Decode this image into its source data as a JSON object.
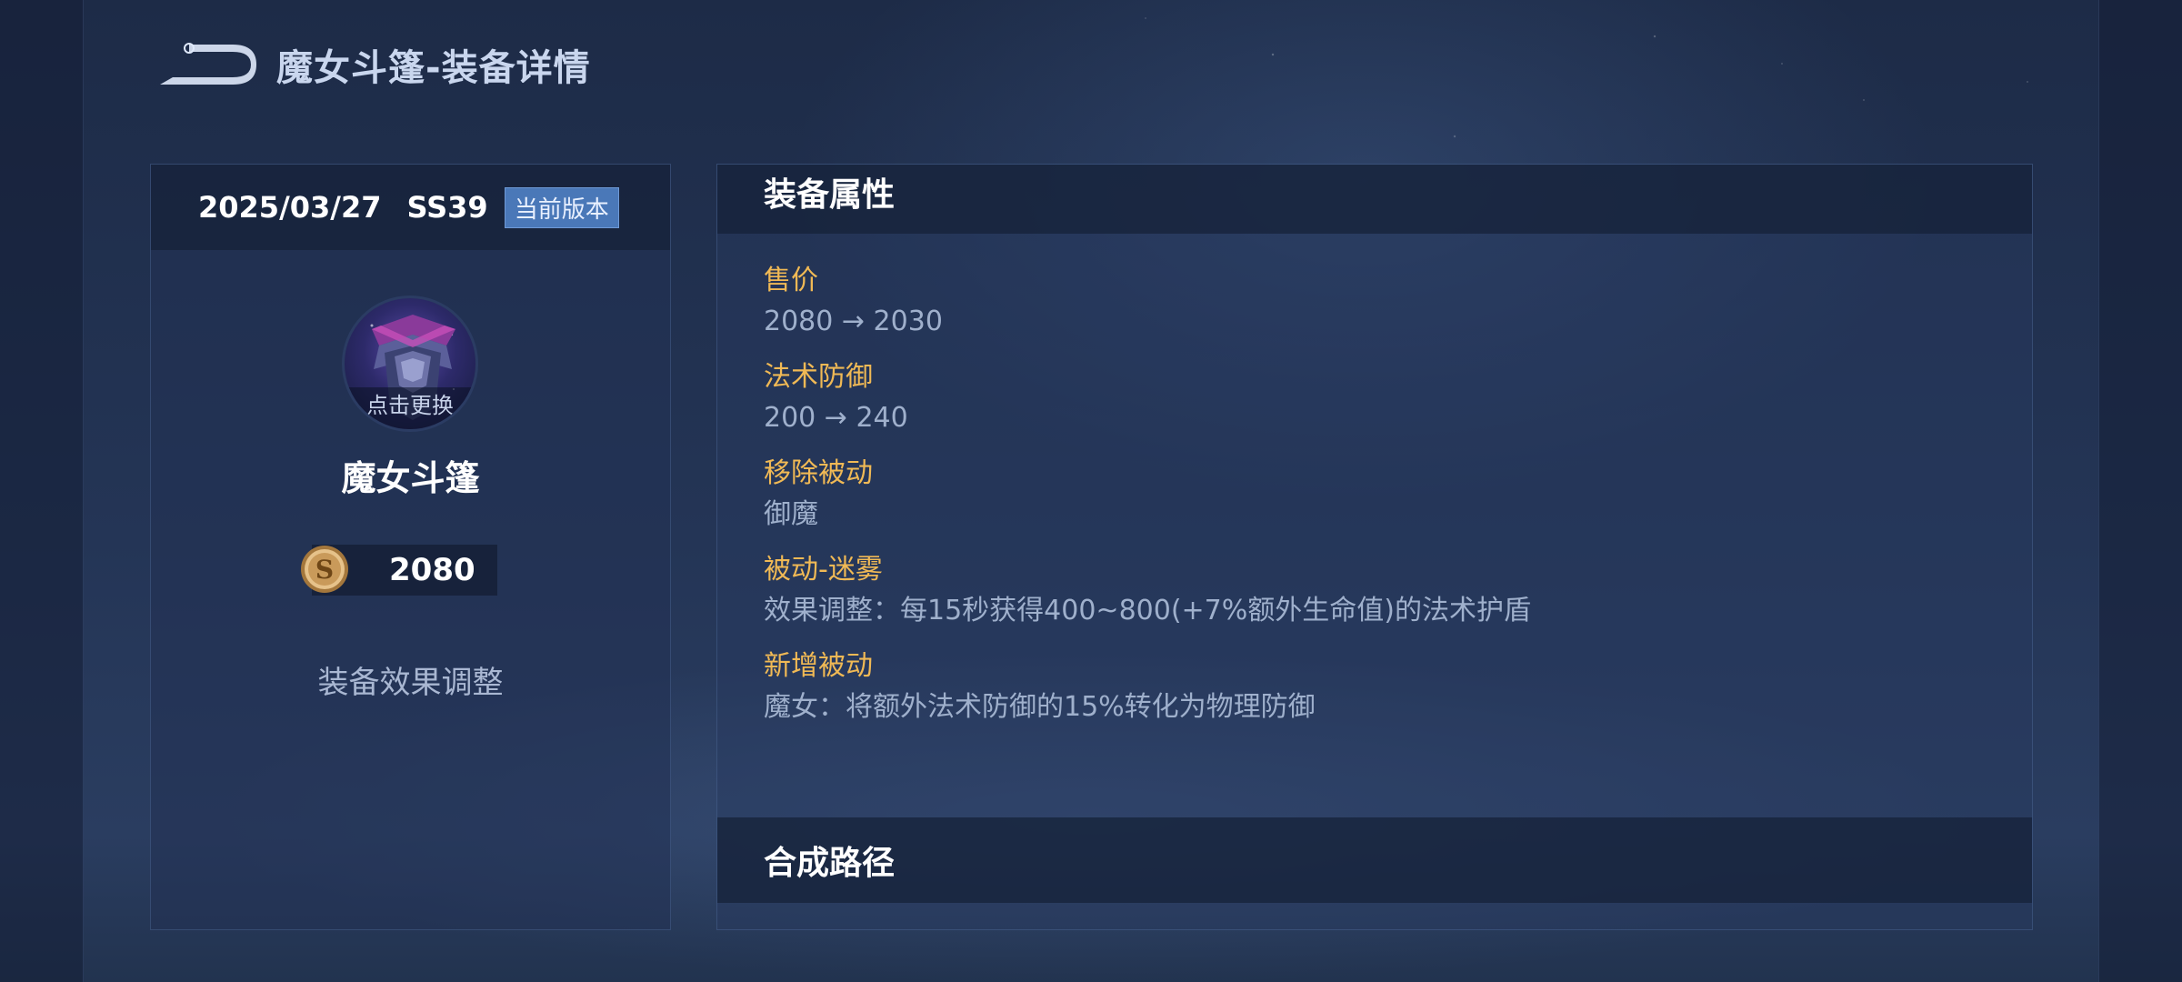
{
  "header": {
    "title": "魔女斗篷-装备详情",
    "back_icon": "back-arrow-icon"
  },
  "left_panel": {
    "version_date": "2025/03/27",
    "version_season": "SS39",
    "version_badge": "当前版本",
    "avatar_caption": "点击更换",
    "item_name": "魔女斗篷",
    "coin_icon": "gold-coin-icon",
    "price": "2080",
    "effect_label": "装备效果调整"
  },
  "right_panel": {
    "attributes_title": "装备属性",
    "attributes": [
      {
        "label": "售价",
        "value": "2080 → 2030"
      },
      {
        "label": "法术防御",
        "value": "200 → 240"
      },
      {
        "label": "移除被动",
        "value": "御魔"
      },
      {
        "label": "被动-迷雾",
        "value": "效果调整：每15秒获得400~800(+7%额外生命值)的法术护盾"
      },
      {
        "label": "新增被动",
        "value": "魔女：将额外法术防御的15%转化为物理防御"
      }
    ],
    "path_title": "合成路径"
  },
  "colors": {
    "accent_gold": "#f0b955",
    "badge_blue": "#4a78b8",
    "value_text": "#9fb0cc"
  }
}
